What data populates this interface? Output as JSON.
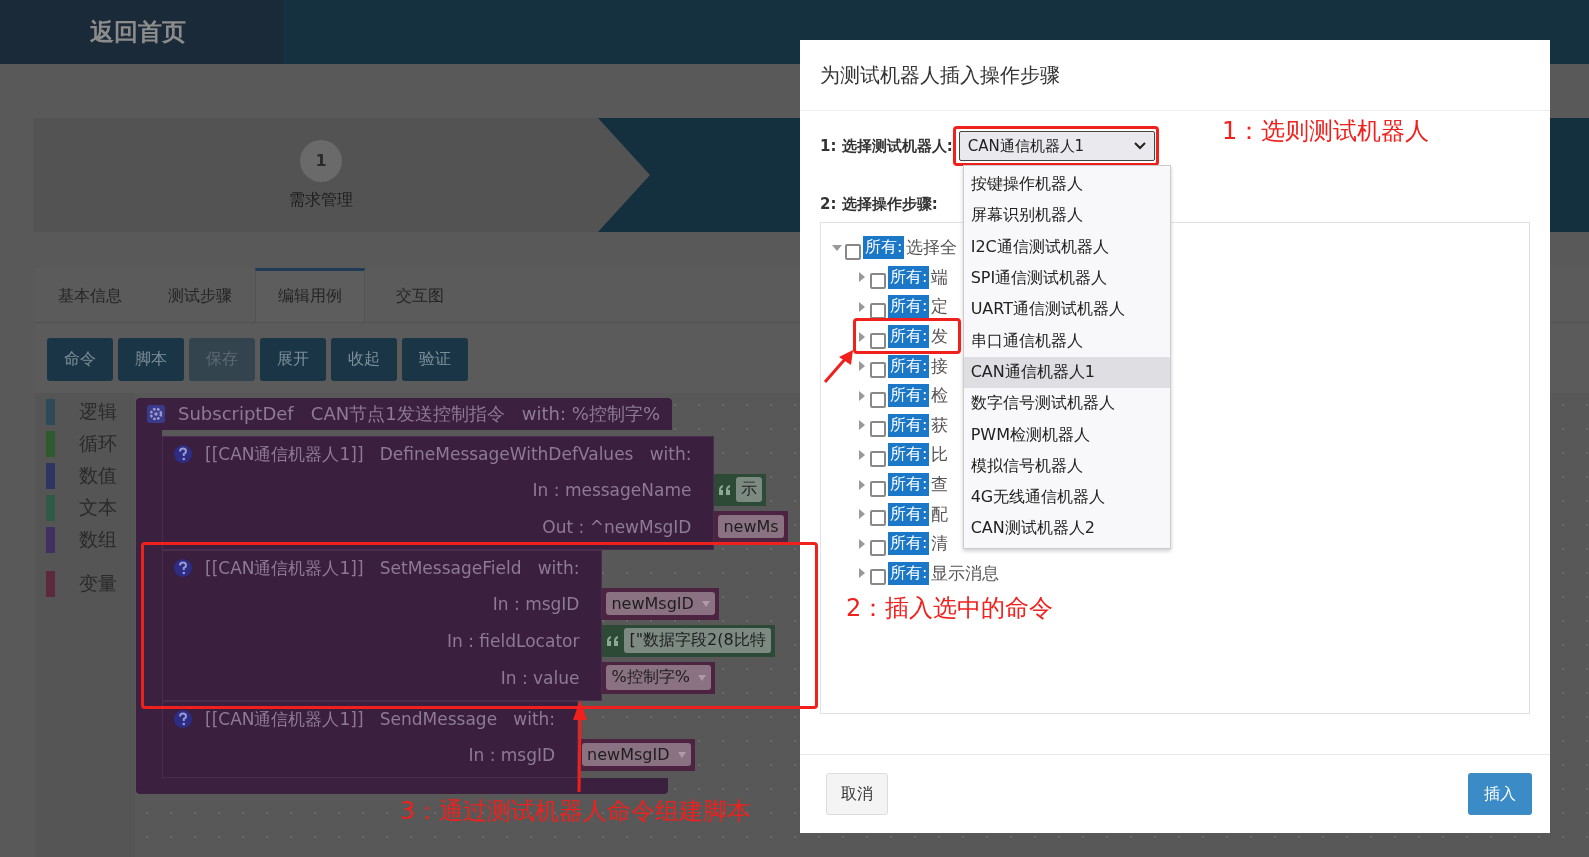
{
  "header": {
    "home_link": "返回首页"
  },
  "steps": [
    {
      "number": "1",
      "label": "需求管理",
      "selected": false
    }
  ],
  "tabs": [
    {
      "label": "基本信息",
      "selected": false
    },
    {
      "label": "测试步骤",
      "selected": false
    },
    {
      "label": "编辑用例",
      "selected": true
    },
    {
      "label": "交互图",
      "selected": false
    }
  ],
  "toolbar": [
    {
      "label": "命令",
      "disabled": false
    },
    {
      "label": "脚本",
      "disabled": false
    },
    {
      "label": "保存",
      "disabled": true
    },
    {
      "label": "展开",
      "disabled": false
    },
    {
      "label": "收起",
      "disabled": false
    },
    {
      "label": "验证",
      "disabled": false
    }
  ],
  "categories": [
    {
      "label": "逻辑",
      "color": "#2e4a58"
    },
    {
      "label": "循环",
      "color": "#2f5a2f"
    },
    {
      "label": "数值",
      "color": "#2e3560"
    },
    {
      "label": "文本",
      "color": "#2f5a45"
    },
    {
      "label": "数组",
      "color": "#3e3060"
    },
    {
      "label": "变量",
      "color": "#5c2a3c"
    }
  ],
  "script": {
    "header": "SubscriptDef   CAN节点1发送控制指令   with: %控制字%",
    "commands": [
      {
        "title": "[[CAN通信机器人1]]   DefineMessageWithDefValues   with:",
        "params": [
          {
            "label": "In : messageName",
            "kind": "text",
            "value": "示",
            "dropdown": false
          },
          {
            "label": "Out : ^newMsgID",
            "kind": "variable",
            "value": "newMs",
            "dropdown": false
          }
        ]
      },
      {
        "title": "[[CAN通信机器人1]]   SetMessageField   with:",
        "params": [
          {
            "label": "In : msgID",
            "kind": "variable",
            "value": "newMsgID",
            "dropdown": true
          },
          {
            "label": "In : fieldLocator",
            "kind": "text",
            "value": "[\"数据字段2(8比特",
            "dropdown": false
          },
          {
            "label": "In : value",
            "kind": "variable",
            "value": "%控制字%",
            "dropdown": true
          }
        ]
      },
      {
        "title": "[[CAN通信机器人1]]   SendMessage   with:",
        "params": [
          {
            "label": "In : msgID",
            "kind": "variable",
            "value": "newMsgID",
            "dropdown": true
          }
        ]
      }
    ]
  },
  "dialog": {
    "title": "为测试机器人插入操作步骤",
    "robot_label": "1: 选择测试机器人:",
    "robot_select": {
      "value": "CAN通信机器人1",
      "expanded": true,
      "options": [
        {
          "label": "按键操作机器人",
          "selected": false
        },
        {
          "label": "屏幕识别机器人",
          "selected": false
        },
        {
          "label": "I2C通信测试机器人",
          "selected": false
        },
        {
          "label": "SPI通信测试机器人",
          "selected": false
        },
        {
          "label": "UART通信测试机器人",
          "selected": false
        },
        {
          "label": "串口通信机器人",
          "selected": false
        },
        {
          "label": "CAN通信机器人1",
          "selected": true
        },
        {
          "label": "数字信号测试机器人",
          "selected": false
        },
        {
          "label": "PWM检测机器人",
          "selected": false
        },
        {
          "label": "模拟信号机器人",
          "selected": false
        },
        {
          "label": "4G无线通信机器人",
          "selected": false
        },
        {
          "label": "CAN测试机器人2",
          "selected": false
        }
      ]
    },
    "steps_label": "2: 选择操作步骤:",
    "tree": [
      {
        "tag": "所有:",
        "text": "选择全",
        "expanded": true,
        "checked": false,
        "children": [
          {
            "tag": "所有:",
            "text": "端",
            "expanded": false,
            "checked": false
          },
          {
            "tag": "所有:",
            "text": "定",
            "expanded": false,
            "checked": false
          },
          {
            "tag": "所有:",
            "text": "发",
            "expanded": false,
            "checked": false
          },
          {
            "tag": "所有:",
            "text": "接",
            "expanded": false,
            "checked": false
          },
          {
            "tag": "所有:",
            "text": "检",
            "expanded": false,
            "checked": false
          },
          {
            "tag": "所有:",
            "text": "获",
            "expanded": false,
            "checked": false
          },
          {
            "tag": "所有:",
            "text": "比",
            "expanded": false,
            "checked": false
          },
          {
            "tag": "所有:",
            "text": "查",
            "expanded": false,
            "checked": false
          },
          {
            "tag": "所有:",
            "text": "配",
            "expanded": false,
            "checked": false
          },
          {
            "tag": "所有:",
            "text": "清",
            "expanded": false,
            "checked": false
          },
          {
            "tag": "所有:",
            "text": "显示消息",
            "expanded": false,
            "checked": false
          }
        ]
      }
    ],
    "cancel_button": "取消",
    "insert_button": "插入"
  },
  "annotations": [
    {
      "text": "1：选则测试机器人"
    },
    {
      "text": "2：插入选中的命令"
    },
    {
      "text": "3：通过测试机器人命令组建脚本"
    }
  ]
}
